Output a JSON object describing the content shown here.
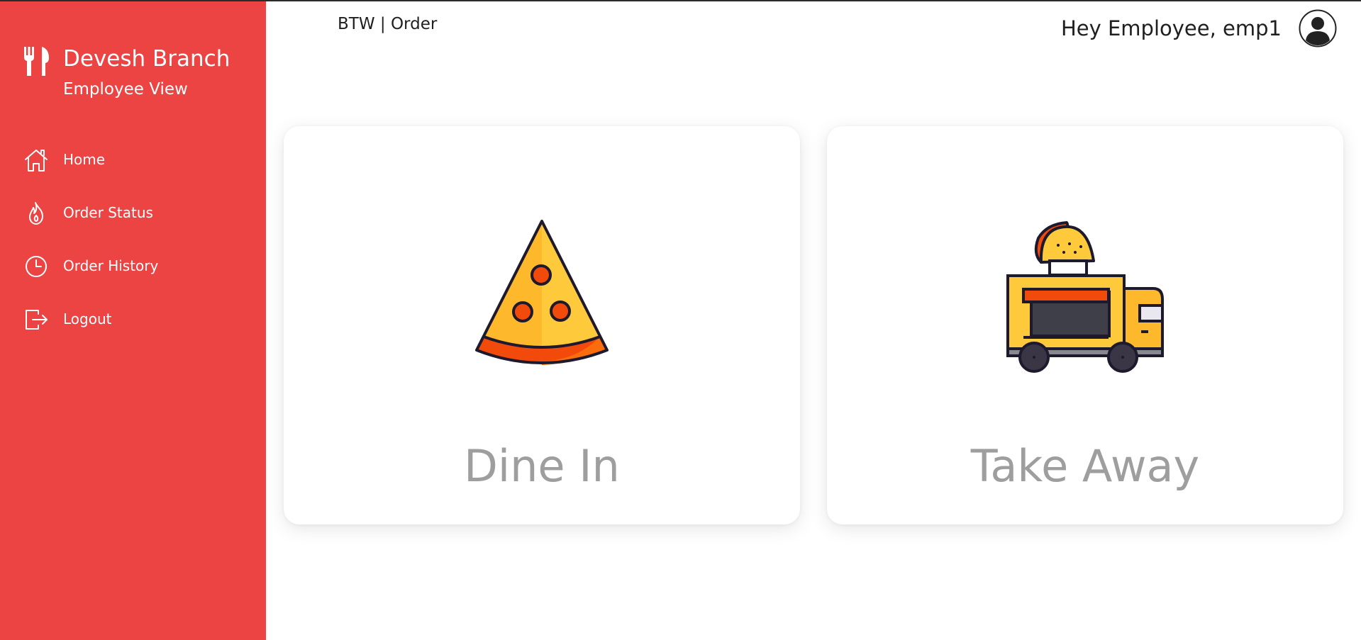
{
  "sidebar": {
    "brand_name": "Devesh Branch",
    "brand_sub": "Employee View",
    "items": [
      {
        "label": "Home",
        "icon": "home-icon"
      },
      {
        "label": "Order Status",
        "icon": "flame-icon"
      },
      {
        "label": "Order History",
        "icon": "clock-icon"
      },
      {
        "label": "Logout",
        "icon": "logout-icon"
      }
    ]
  },
  "header": {
    "title": "BTW | Order",
    "greeting": "Hey Employee, emp1"
  },
  "main": {
    "cards": [
      {
        "label": "Dine In",
        "icon": "pizza-slice-icon"
      },
      {
        "label": "Take Away",
        "icon": "food-truck-icon"
      }
    ]
  },
  "colors": {
    "sidebar_bg": "#ec4343",
    "card_label": "#9e9e9e",
    "text_dark": "#1f1f1f"
  }
}
